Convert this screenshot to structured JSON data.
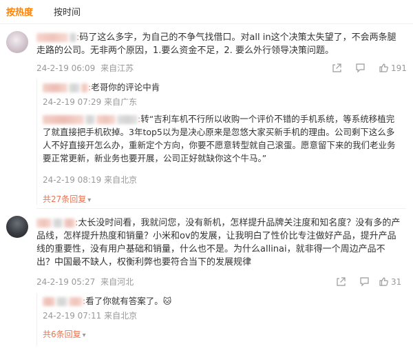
{
  "tabs": [
    {
      "label": "按热度",
      "active": true
    },
    {
      "label": "按时间",
      "active": false
    }
  ],
  "comments": [
    {
      "text": "码了这么多字，为自己的不争气找借口。对all in这个决策太失望了，不会两条腿走路的公司。无非两个原因，1.要么资金不足，2. 要么外行领导决策问题。",
      "date": "24-2-19 06:09",
      "location": "来自江苏",
      "likes": "191",
      "replies": [
        {
          "text": "老哥你的评论中肯",
          "date": "24-2-19 07:29",
          "location": "来自广东"
        },
        {
          "text": "转“吉利车机不行所以收购一个评价不错的手机系统，等系统移植完了就直接把手机砍掉。3年top5以为是决心原来是忽悠大家买新手机的理由。公司剩下这么多人不好直接开怎么办，重新定个方向，你要不愿意转型就自己滚蛋。愿意留下来的我们老业务要正常更新，新业务也要开展，公司正好就缺你这个牛马。”",
          "date": "24-2-19 08:19",
          "location": "来自北京"
        }
      ],
      "more_replies": "共27条回复"
    },
    {
      "text": "太长没时间看，我就问您，没有新机，怎样提升品牌关注度和知名度？没有多的产品线，怎样提升热度和销量？小米和ov的发展，让我明白了性价比专注做好产品，提升产品线的重要性，没有用户基础和销量，什么也不是。为什么allinai，就非得一个周边产品不出？中国最不缺人，权衡利弊也要符合当下的发展规律",
      "date": "24-2-19 05:27",
      "location": "来自河北",
      "likes": "31",
      "replies": [
        {
          "text": "看了你就有答案了。",
          "emoji": "🐱",
          "date": "24-2-19 07:11",
          "location": "来自北京"
        }
      ],
      "more_replies": "共6条回复"
    }
  ],
  "icons": {
    "share": "share-icon",
    "comment": "comment-icon",
    "like": "thumbs-up-icon",
    "more": "chevron-down-icon"
  },
  "colors": {
    "accent": "#ff8200",
    "username": "#eb7350",
    "meta": "#999999"
  }
}
